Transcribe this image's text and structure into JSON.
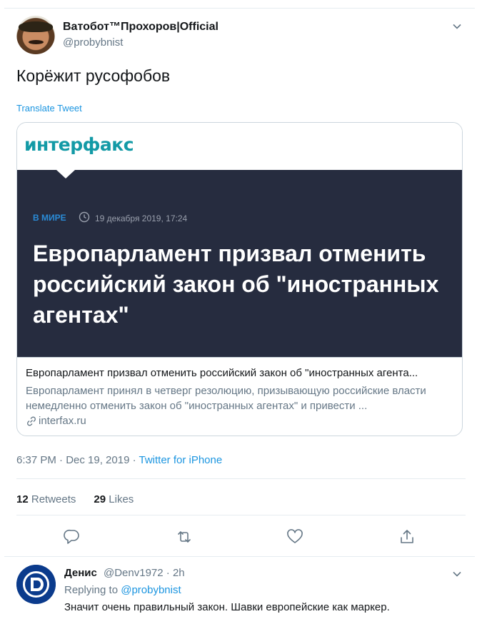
{
  "tweet": {
    "display_name": "Ватобот™Прохоров|Official",
    "handle": "@probybnist",
    "text": "Корёжит русофобов",
    "translate_label": "Translate Tweet",
    "timestamp": "6:37 PM · Dec 19, 2019 · ",
    "source": "Twitter for iPhone"
  },
  "card": {
    "logo_text": "интерфакс",
    "rubric": "В МИРЕ",
    "hero_date": "19 декабря 2019, 17:24",
    "headline": "Европарламент призвал отменить российский закон об \"иностранных агентах\"",
    "title": "Европарламент призвал отменить российский закон об \"иностранных агента...",
    "description": "Европарламент принял в четверг резолюцию, призывающую российские власти немедленно отменить закон об \"иностранных агентах\" и привести ...",
    "domain": "interfax.ru"
  },
  "stats": {
    "retweets_count": "12",
    "retweets_label": "Retweets",
    "likes_count": "29",
    "likes_label": "Likes"
  },
  "actions": {
    "icons": [
      "reply-icon",
      "retweet-icon",
      "like-icon",
      "share-icon"
    ]
  },
  "reply": {
    "display_name": "Денис",
    "handle_time": "@Denv1972 · 2h",
    "replying_prefix": "Replying to ",
    "replying_to": "@probybnist",
    "text": "Значит очень правильный закон. Шавки европейские как маркер."
  },
  "colors": {
    "accent": "#1b95e0",
    "hero_bg": "#262c3f",
    "logo": "#139aa6",
    "secondary_text": "#657786"
  }
}
